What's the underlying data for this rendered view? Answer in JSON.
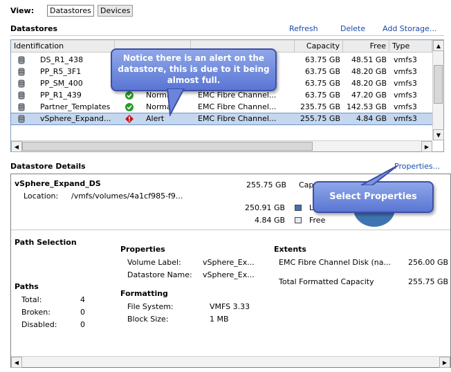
{
  "view": {
    "label": "View:",
    "datastores_btn": "Datastores",
    "devices_btn": "Devices"
  },
  "datastores": {
    "title": "Datastores",
    "actions": {
      "refresh": "Refresh",
      "delete": "Delete",
      "add_storage": "Add Storage..."
    },
    "columns": {
      "identification": "Identification",
      "capacity": "Capacity",
      "free": "Free",
      "type": "Type"
    },
    "rows": [
      {
        "name": "DS_R1_438",
        "status": "",
        "device": "",
        "capacity": "63.75 GB",
        "free": "48.51 GB",
        "type": "vmfs3"
      },
      {
        "name": "PP_R5_3F1",
        "status": "",
        "device": "",
        "capacity": "63.75 GB",
        "free": "48.20 GB",
        "type": "vmfs3"
      },
      {
        "name": "PP_SM_400",
        "status": "",
        "device": "",
        "capacity": "63.75 GB",
        "free": "48.20 GB",
        "type": "vmfs3"
      },
      {
        "name": "PP_R1_439",
        "status": "Normal",
        "device": "EMC Fibre Channel...",
        "capacity": "63.75 GB",
        "free": "47.20 GB",
        "type": "vmfs3"
      },
      {
        "name": "Partner_Templates",
        "status": "Normal",
        "device": "EMC Fibre Channel...",
        "capacity": "235.75 GB",
        "free": "142.53 GB",
        "type": "vmfs3"
      },
      {
        "name": "vSphere_Expand...",
        "status": "Alert",
        "device": "EMC Fibre Channel...",
        "capacity": "255.75 GB",
        "free": "4.84 GB",
        "type": "vmfs3"
      }
    ]
  },
  "callout_alert": {
    "text": "Notice there is an alert on the datastore, this is due to it being almost full."
  },
  "callout_props": {
    "text": "Select Properties"
  },
  "details": {
    "title": "Datastore Details",
    "properties_link": "Properties...",
    "name": "vSphere_Expand_DS",
    "capacity_total": "255.75 GB",
    "capacity_label": "Capa",
    "location_label": "Location:",
    "location_value": "/vmfs/volumes/4a1cf985-f9...",
    "used_value": "250.91 GB",
    "used_label": "L",
    "free_value": "4.84 GB",
    "free_label": "Free",
    "path_selection": "Path Selection",
    "paths": {
      "title": "Paths",
      "total_label": "Total:",
      "total_value": "4",
      "broken_label": "Broken:",
      "broken_value": "0",
      "disabled_label": "Disabled:",
      "disabled_value": "0"
    },
    "properties": {
      "title": "Properties",
      "volume_label": "Volume Label:",
      "volume_value": "vSphere_Ex...",
      "ds_name_label": "Datastore Name:",
      "ds_name_value": "vSphere_Ex..."
    },
    "formatting": {
      "title": "Formatting",
      "fs_label": "File System:",
      "fs_value": "VMFS 3.33",
      "bs_label": "Block Size:",
      "bs_value": "1 MB"
    },
    "extents": {
      "title": "Extents",
      "disk_label": "EMC Fibre Channel Disk (na...",
      "disk_value": "256.00 GB",
      "formatted_label": "Total Formatted Capacity",
      "formatted_value": "255.75 GB"
    }
  },
  "colors": {
    "link": "#1a4aa8",
    "selected_row": "#c5d7ee",
    "callout": "#6b86dc",
    "ok": "#2a9a2a",
    "alert": "#cc1111"
  }
}
